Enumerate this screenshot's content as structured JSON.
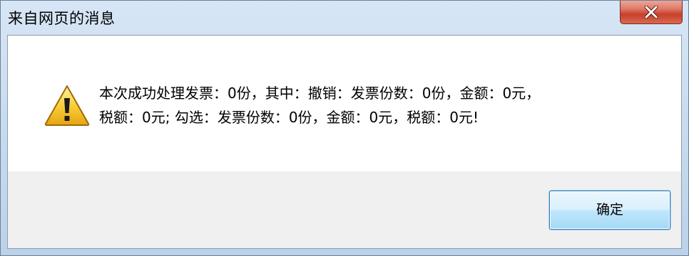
{
  "window": {
    "title": "来自网页的消息"
  },
  "dialog": {
    "icon": "warning-icon",
    "message_line1": "本次成功处理发票：0份，其中：撤销：发票份数：0份，金额：0元，",
    "message_line2": "税额：0元; 勾选：发票份数：0份，金额：0元，税额：0元!",
    "ok_label": "确定"
  },
  "colors": {
    "title_bar_top": "#d7e6f6",
    "title_bar_bottom": "#bcd2ea",
    "close_button": "#c7402c",
    "ok_button_border": "#3c7fb1",
    "content_bg": "#ffffff",
    "footer_bg": "#f0f0f0"
  }
}
